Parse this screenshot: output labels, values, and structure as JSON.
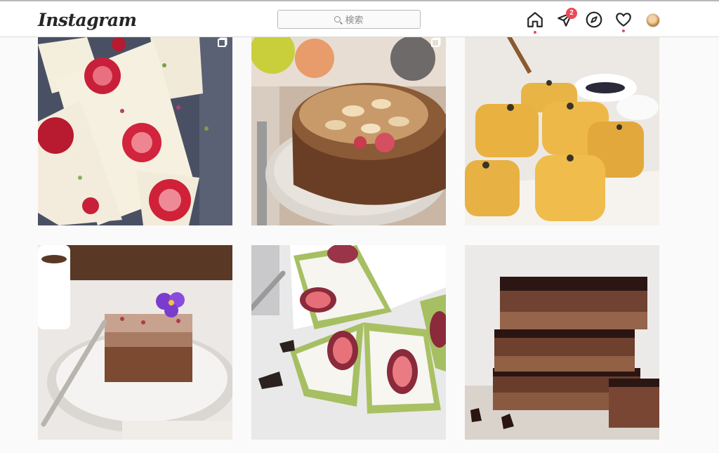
{
  "header": {
    "logo": "Instagram",
    "search_placeholder": "検索",
    "notification_count": "2"
  },
  "icons": [
    "home-icon",
    "direct-icon",
    "explore-icon",
    "heart-icon",
    "avatar"
  ],
  "posts": [
    {
      "subject": "white-chocolate-bark-strawberries",
      "multi": true
    },
    {
      "subject": "almond-cake",
      "multi": true
    },
    {
      "subject": "pumpkin-scones",
      "multi": false
    },
    {
      "subject": "chocolate-cake-slice-violet",
      "multi": false
    },
    {
      "subject": "fig-tart-pistachio",
      "multi": false
    },
    {
      "subject": "chocolate-bars-stacked",
      "multi": false
    }
  ]
}
